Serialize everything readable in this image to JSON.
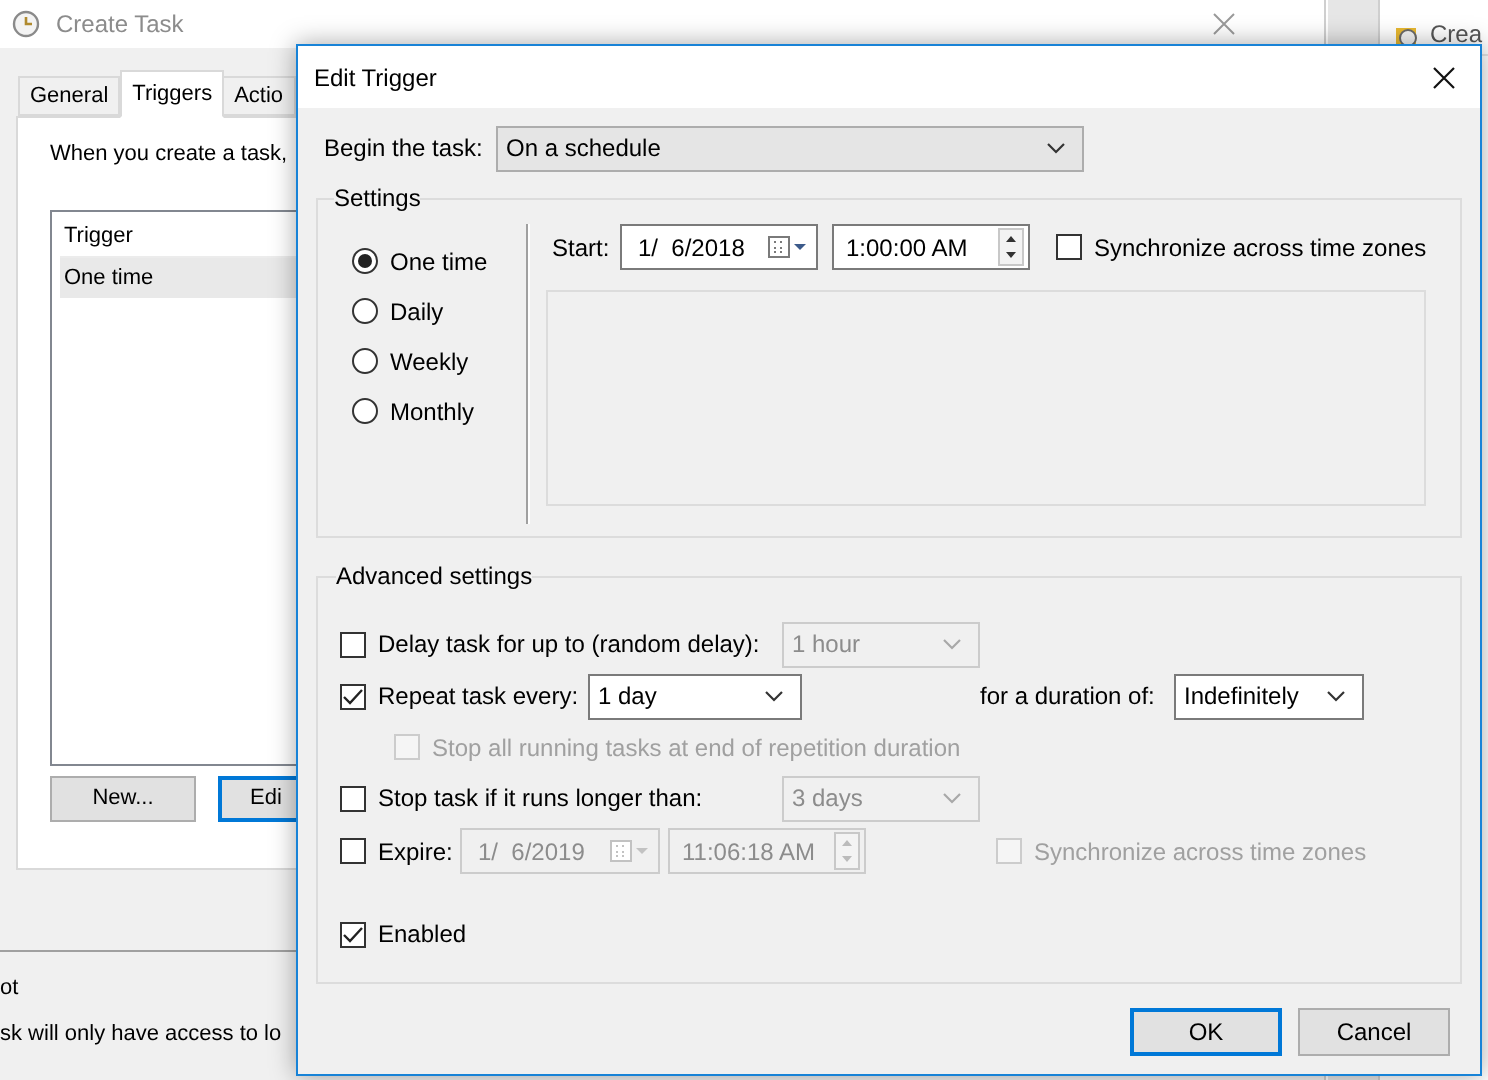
{
  "create_task_window": {
    "title": "Create Task",
    "tabs": [
      {
        "label": "General",
        "selected": false
      },
      {
        "label": "Triggers",
        "selected": true
      },
      {
        "label": "Actio",
        "selected": false
      }
    ],
    "description": "When you create a task,",
    "trigger_list": {
      "columns": [
        "Trigger"
      ],
      "rows": [
        {
          "cells": [
            "One time"
          ],
          "selected": true
        }
      ]
    },
    "buttons": [
      {
        "label": "New...",
        "focused": false
      },
      {
        "label": "Edi",
        "focused": true
      }
    ],
    "lower_texts": [
      "ot",
      "sk will only have access to lo"
    ]
  },
  "side_panel": {
    "header": "Crea"
  },
  "dialog": {
    "title": "Edit Trigger",
    "begin_label": "Begin the task:",
    "begin_value": "On a schedule",
    "settings": {
      "legend": "Settings",
      "schedule_options": [
        {
          "label": "One time",
          "selected": true
        },
        {
          "label": "Daily",
          "selected": false
        },
        {
          "label": "Weekly",
          "selected": false
        },
        {
          "label": "Monthly",
          "selected": false
        }
      ],
      "start_label": "Start:",
      "start_date": "1/  6/2018",
      "start_time": "1:00:00 AM",
      "sync": {
        "label": "Synchronize across time zones",
        "checked": false,
        "disabled": false
      }
    },
    "advanced": {
      "legend": "Advanced settings",
      "delay": {
        "label": "Delay task for up to (random delay):",
        "checked": false,
        "disabled": false,
        "value": "1 hour",
        "value_disabled": true
      },
      "repeat": {
        "label": "Repeat task every:",
        "checked": true,
        "disabled": false,
        "value": "1 day",
        "value_disabled": false,
        "duration_label": "for a duration of:",
        "duration_value": "Indefinitely"
      },
      "stop_all": {
        "label": "Stop all running tasks at end of repetition duration",
        "checked": false,
        "disabled": true
      },
      "stop_task": {
        "label": "Stop task if it runs longer than:",
        "checked": false,
        "disabled": false,
        "value": "3 days",
        "value_disabled": true
      },
      "expire": {
        "label": "Expire:",
        "checked": false,
        "disabled": false,
        "date": "1/  6/2019",
        "time": "11:06:18 AM",
        "value_disabled": true
      },
      "expire_sync": {
        "label": "Synchronize across time zones",
        "checked": false,
        "disabled": true
      },
      "enabled": {
        "label": "Enabled",
        "checked": true,
        "disabled": false
      }
    },
    "buttons": [
      {
        "label": "OK",
        "default": true
      },
      {
        "label": "Cancel",
        "default": false
      }
    ]
  }
}
